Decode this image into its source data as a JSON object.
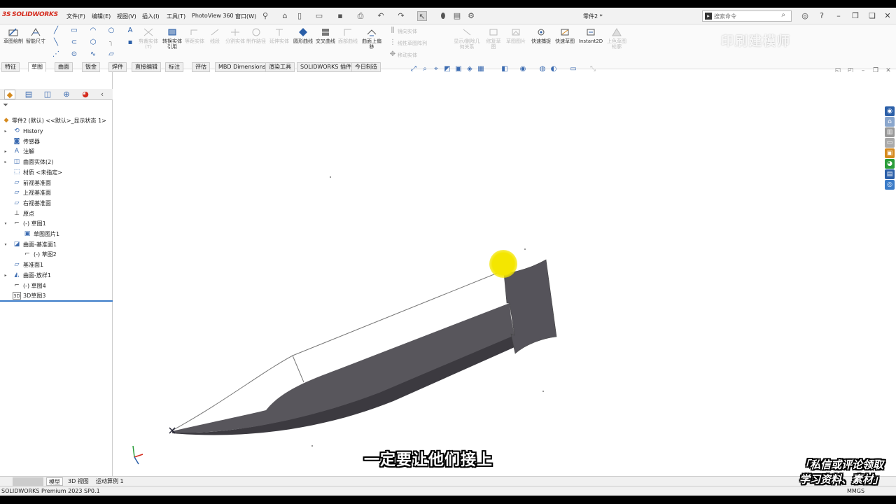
{
  "app": {
    "logo_text": "SOLIDWORKS",
    "document_title": "零件2 *"
  },
  "menubar": {
    "items": [
      "文件(F)",
      "编辑(E)",
      "视图(V)",
      "插入(I)",
      "工具(T)",
      "PhotoView 360",
      "窗口(W)"
    ],
    "search_placeholder": "搜索命令"
  },
  "ribbon": {
    "sketch_label": "草图绘制",
    "smart_dim_label": "智能尺寸",
    "trim_label": "剪裁实体(T)",
    "convert_label": "转换实体引用",
    "offset_label": "等距实体",
    "offset_surface_label": "线段",
    "split_label": "分割实体",
    "make_path_label": "制作路径",
    "text_label": "延伸实体",
    "surface_curve_label": "圆形曲线",
    "intersection_label": "交叉曲线",
    "face_curves_label": "面部曲线",
    "sketch_on_surface_label": "曲面上偏移",
    "mirror_label": "镜向实体",
    "linear_pattern_label": "线性草图阵列",
    "move_label": "移动实体",
    "display_relations_label": "显示/删除几何关系",
    "repair_label": "修复草图",
    "sketch_picture_label": "草图图片",
    "rapid_sketch_label": "快速捕捉",
    "quick_sketch_label": "快速草图",
    "instant2d_label": "Instant2D",
    "shaded_sketch_label": "上色草图轮廓",
    "watermark": "印刷建模师"
  },
  "command_tabs": [
    "特征",
    "草图",
    "曲面",
    "钣金",
    "焊件",
    "直接编辑",
    "标注",
    "评估",
    "MBD Dimensions",
    "渲染工具",
    "SOLIDWORKS 插件",
    "今日制造"
  ],
  "active_tab_index": 1,
  "tree": {
    "root": "零件2 (默认) <<默认>_显示状态 1>",
    "items": [
      {
        "label": "History",
        "indent": 0,
        "arrow": "▸",
        "icon": "history-icon"
      },
      {
        "label": "传感器",
        "indent": 0,
        "arrow": "",
        "icon": "sensor-icon"
      },
      {
        "label": "注解",
        "indent": 0,
        "arrow": "▸",
        "icon": "annotation-icon"
      },
      {
        "label": "曲面实体(2)",
        "indent": 0,
        "arrow": "▸",
        "icon": "surface-bodies-icon"
      },
      {
        "label": "材质 <未指定>",
        "indent": 0,
        "arrow": "",
        "icon": "material-icon"
      },
      {
        "label": "前视基准面",
        "indent": 0,
        "arrow": "",
        "icon": "plane-icon"
      },
      {
        "label": "上视基准面",
        "indent": 0,
        "arrow": "",
        "icon": "plane-icon"
      },
      {
        "label": "右视基准面",
        "indent": 0,
        "arrow": "",
        "icon": "plane-icon"
      },
      {
        "label": "原点",
        "indent": 0,
        "arrow": "",
        "icon": "origin-icon"
      },
      {
        "label": "(-) 草图1",
        "indent": 0,
        "arrow": "▾",
        "icon": "sketch-icon"
      },
      {
        "label": "草图图片1",
        "indent": 1,
        "arrow": "",
        "icon": "sketch-picture-icon"
      },
      {
        "label": "曲面-基准面1",
        "indent": 0,
        "arrow": "▾",
        "icon": "planar-surface-icon"
      },
      {
        "label": "(-) 草图2",
        "indent": 1,
        "arrow": "",
        "icon": "sketch-icon"
      },
      {
        "label": "基准面1",
        "indent": 0,
        "arrow": "",
        "icon": "plane-icon"
      },
      {
        "label": "曲面-放样1",
        "indent": 0,
        "arrow": "▸",
        "icon": "loft-surface-icon"
      },
      {
        "label": "(-) 草图4",
        "indent": 0,
        "arrow": "",
        "icon": "sketch-icon"
      },
      {
        "label": "3D草图3",
        "indent": 0,
        "arrow": "",
        "icon": "3d-sketch-icon"
      }
    ]
  },
  "bottom_tabs": [
    "模型",
    "3D 视图",
    "运动算例 1"
  ],
  "status": {
    "left": "SOLIDWORKS Premium 2023 SP0.1",
    "right": "MMGS"
  },
  "overlay": {
    "subtitle": "一定要让他们接上",
    "promo_line1": "「私信或评论领取",
    "promo_line2": "学习资料、素材」"
  },
  "colors": {
    "surface_top": "#58565c",
    "surface_side": "#3c3a40",
    "accent": "#3a7bc8",
    "logo_red": "#d52b1e",
    "cursor_highlight": "#f4e600"
  }
}
